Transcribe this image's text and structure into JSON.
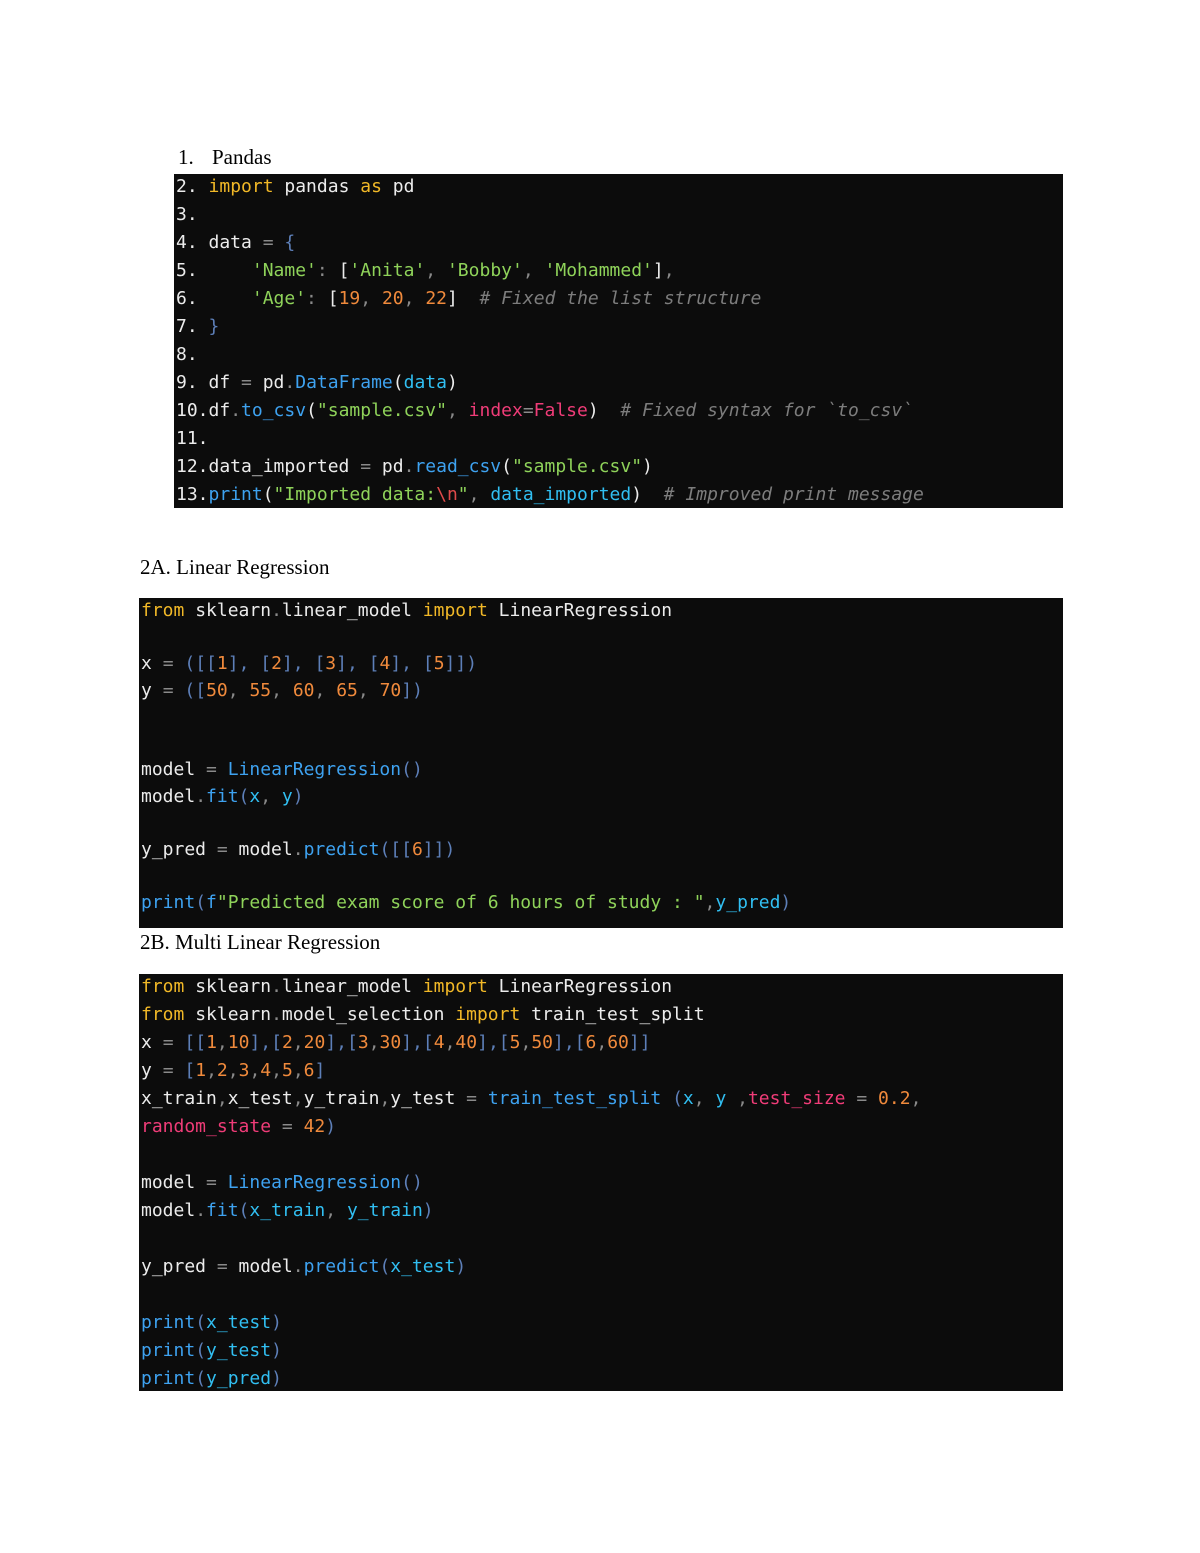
{
  "headings": {
    "pandas_number": "1.",
    "pandas": "Pandas",
    "linear": "2A. Linear Regression",
    "multi": "2B. Multi Linear Regression"
  },
  "code_blocks": [
    {
      "name": "pandas",
      "lines": [
        [
          [
            "w",
            "2. "
          ],
          [
            "kw",
            "import"
          ],
          [
            "w",
            " pandas "
          ],
          [
            "kw",
            "as"
          ],
          [
            "w",
            " pd"
          ]
        ],
        [
          [
            "w",
            "3."
          ]
        ],
        [
          [
            "w",
            "4. data "
          ],
          [
            "g",
            "="
          ],
          [
            "w",
            " "
          ],
          [
            "br2",
            "{"
          ]
        ],
        [
          [
            "w",
            "5.     "
          ],
          [
            "str",
            "'Name'"
          ],
          [
            "g",
            ": "
          ],
          [
            "br",
            "["
          ],
          [
            "str",
            "'Anita'"
          ],
          [
            "g",
            ", "
          ],
          [
            "str",
            "'Bobby'"
          ],
          [
            "g",
            ", "
          ],
          [
            "str",
            "'Mohammed'"
          ],
          [
            "br",
            "]"
          ],
          [
            "g",
            ","
          ]
        ],
        [
          [
            "w",
            "6.     "
          ],
          [
            "str",
            "'Age'"
          ],
          [
            "g",
            ": "
          ],
          [
            "br",
            "["
          ],
          [
            "num",
            "19"
          ],
          [
            "g",
            ", "
          ],
          [
            "num",
            "20"
          ],
          [
            "g",
            ", "
          ],
          [
            "num",
            "22"
          ],
          [
            "br",
            "]"
          ],
          [
            "w",
            "  "
          ],
          [
            "cm",
            "# Fixed the list structure"
          ]
        ],
        [
          [
            "w",
            "7. "
          ],
          [
            "br2",
            "}"
          ]
        ],
        [
          [
            "w",
            "8."
          ]
        ],
        [
          [
            "w",
            "9. df "
          ],
          [
            "g",
            "="
          ],
          [
            "w",
            " pd"
          ],
          [
            "g",
            "."
          ],
          [
            "fn",
            "DataFrame"
          ],
          [
            "br",
            "("
          ],
          [
            "var",
            "data"
          ],
          [
            "br",
            ")"
          ]
        ],
        [
          [
            "w",
            "10.df"
          ],
          [
            "g",
            "."
          ],
          [
            "fn",
            "to_csv"
          ],
          [
            "br",
            "("
          ],
          [
            "str",
            "\"sample.csv\""
          ],
          [
            "g",
            ", "
          ],
          [
            "param",
            "index"
          ],
          [
            "g",
            "="
          ],
          [
            "param",
            "False"
          ],
          [
            "br",
            ")"
          ],
          [
            "w",
            "  "
          ],
          [
            "cm",
            "# Fixed syntax for `to_csv`"
          ]
        ],
        [
          [
            "w",
            "11."
          ]
        ],
        [
          [
            "w",
            "12.data_imported "
          ],
          [
            "g",
            "="
          ],
          [
            "w",
            " pd"
          ],
          [
            "g",
            "."
          ],
          [
            "fn",
            "read_csv"
          ],
          [
            "br",
            "("
          ],
          [
            "str",
            "\"sample.csv\""
          ],
          [
            "br",
            ")"
          ]
        ],
        [
          [
            "w",
            "13."
          ],
          [
            "fn",
            "print"
          ],
          [
            "br",
            "("
          ],
          [
            "str",
            "\"Imported data:"
          ],
          [
            "esc",
            "\\n"
          ],
          [
            "str",
            "\""
          ],
          [
            "g",
            ", "
          ],
          [
            "var",
            "data_imported"
          ],
          [
            "br",
            ")"
          ],
          [
            "w",
            "  "
          ],
          [
            "cm",
            "# Improved print message"
          ]
        ]
      ]
    },
    {
      "name": "linear-regression",
      "lines": [
        [
          [
            "kw",
            "from"
          ],
          [
            "w",
            " sklearn"
          ],
          [
            "g",
            "."
          ],
          [
            "w",
            "linear_model "
          ],
          [
            "kw",
            "import"
          ],
          [
            "w",
            " LinearRegression"
          ]
        ],
        [],
        [
          [
            "w",
            "x "
          ],
          [
            "g",
            "="
          ],
          [
            "w",
            " "
          ],
          [
            "br2",
            "([["
          ],
          [
            "num",
            "1"
          ],
          [
            "br2",
            "], ["
          ],
          [
            "num",
            "2"
          ],
          [
            "br2",
            "], ["
          ],
          [
            "num",
            "3"
          ],
          [
            "br2",
            "], ["
          ],
          [
            "num",
            "4"
          ],
          [
            "br2",
            "], ["
          ],
          [
            "num",
            "5"
          ],
          [
            "br2",
            "]])"
          ]
        ],
        [
          [
            "w",
            "y "
          ],
          [
            "g",
            "="
          ],
          [
            "w",
            " "
          ],
          [
            "br2",
            "(["
          ],
          [
            "num",
            "50"
          ],
          [
            "g",
            ", "
          ],
          [
            "num",
            "55"
          ],
          [
            "g",
            ", "
          ],
          [
            "num",
            "60"
          ],
          [
            "g",
            ", "
          ],
          [
            "num",
            "65"
          ],
          [
            "g",
            ", "
          ],
          [
            "num",
            "70"
          ],
          [
            "br2",
            "])"
          ]
        ],
        [],
        [],
        [
          [
            "w",
            "model "
          ],
          [
            "g",
            "="
          ],
          [
            "w",
            " "
          ],
          [
            "fn",
            "LinearRegression"
          ],
          [
            "br2",
            "()"
          ]
        ],
        [
          [
            "w",
            "model"
          ],
          [
            "g",
            "."
          ],
          [
            "fn",
            "fit"
          ],
          [
            "br2",
            "("
          ],
          [
            "var",
            "x"
          ],
          [
            "g",
            ", "
          ],
          [
            "var",
            "y"
          ],
          [
            "br2",
            ")"
          ]
        ],
        [],
        [
          [
            "w",
            "y_pred "
          ],
          [
            "g",
            "="
          ],
          [
            "w",
            " model"
          ],
          [
            "g",
            "."
          ],
          [
            "fn",
            "predict"
          ],
          [
            "br2",
            "([["
          ],
          [
            "num",
            "6"
          ],
          [
            "br2",
            "]])"
          ]
        ],
        [],
        [
          [
            "fn",
            "print"
          ],
          [
            "br2",
            "("
          ],
          [
            "fn",
            "f"
          ],
          [
            "str",
            "\"Predicted exam score of 6 hours of study : \""
          ],
          [
            "g",
            ","
          ],
          [
            "var",
            "y_pred"
          ],
          [
            "br2",
            ")"
          ]
        ]
      ]
    },
    {
      "name": "multi-linear-regression",
      "lines": [
        [
          [
            "kw",
            "from"
          ],
          [
            "w",
            " sklearn"
          ],
          [
            "g",
            "."
          ],
          [
            "w",
            "linear_model "
          ],
          [
            "kw",
            "import"
          ],
          [
            "w",
            " LinearRegression"
          ]
        ],
        [
          [
            "kw",
            "from"
          ],
          [
            "w",
            " sklearn"
          ],
          [
            "g",
            "."
          ],
          [
            "w",
            "model_selection "
          ],
          [
            "kw",
            "import"
          ],
          [
            "w",
            " train_test_split"
          ]
        ],
        [
          [
            "w",
            "x "
          ],
          [
            "g",
            "="
          ],
          [
            "w",
            " "
          ],
          [
            "br2",
            "[["
          ],
          [
            "num",
            "1"
          ],
          [
            "g",
            ","
          ],
          [
            "num",
            "10"
          ],
          [
            "br2",
            "],["
          ],
          [
            "num",
            "2"
          ],
          [
            "g",
            ","
          ],
          [
            "num",
            "20"
          ],
          [
            "br2",
            "],["
          ],
          [
            "num",
            "3"
          ],
          [
            "g",
            ","
          ],
          [
            "num",
            "30"
          ],
          [
            "br2",
            "],["
          ],
          [
            "num",
            "4"
          ],
          [
            "g",
            ","
          ],
          [
            "num",
            "40"
          ],
          [
            "br2",
            "],["
          ],
          [
            "num",
            "5"
          ],
          [
            "g",
            ","
          ],
          [
            "num",
            "50"
          ],
          [
            "br2",
            "],["
          ],
          [
            "num",
            "6"
          ],
          [
            "g",
            ","
          ],
          [
            "num",
            "60"
          ],
          [
            "br2",
            "]]"
          ]
        ],
        [
          [
            "w",
            "y "
          ],
          [
            "g",
            "="
          ],
          [
            "w",
            " "
          ],
          [
            "br2",
            "["
          ],
          [
            "num",
            "1"
          ],
          [
            "g",
            ","
          ],
          [
            "num",
            "2"
          ],
          [
            "g",
            ","
          ],
          [
            "num",
            "3"
          ],
          [
            "g",
            ","
          ],
          [
            "num",
            "4"
          ],
          [
            "g",
            ","
          ],
          [
            "num",
            "5"
          ],
          [
            "g",
            ","
          ],
          [
            "num",
            "6"
          ],
          [
            "br2",
            "]"
          ]
        ],
        [
          [
            "w",
            "x_train"
          ],
          [
            "g",
            ","
          ],
          [
            "w",
            "x_test"
          ],
          [
            "g",
            ","
          ],
          [
            "w",
            "y_train"
          ],
          [
            "g",
            ","
          ],
          [
            "w",
            "y_test "
          ],
          [
            "g",
            "="
          ],
          [
            "w",
            " "
          ],
          [
            "fn",
            "train_test_split"
          ],
          [
            "w",
            " "
          ],
          [
            "br2",
            "("
          ],
          [
            "var",
            "x"
          ],
          [
            "g",
            ", "
          ],
          [
            "var",
            "y"
          ],
          [
            "w",
            " "
          ],
          [
            "g",
            ","
          ],
          [
            "param",
            "test_size"
          ],
          [
            "w",
            " "
          ],
          [
            "g",
            "="
          ],
          [
            "w",
            " "
          ],
          [
            "num",
            "0.2"
          ],
          [
            "g",
            ","
          ]
        ],
        [
          [
            "param",
            "random_state"
          ],
          [
            "w",
            " "
          ],
          [
            "g",
            "="
          ],
          [
            "w",
            " "
          ],
          [
            "num",
            "42"
          ],
          [
            "br2",
            ")"
          ]
        ],
        [],
        [
          [
            "w",
            "model "
          ],
          [
            "g",
            "="
          ],
          [
            "w",
            " "
          ],
          [
            "fn",
            "LinearRegression"
          ],
          [
            "br2",
            "()"
          ]
        ],
        [
          [
            "w",
            "model"
          ],
          [
            "g",
            "."
          ],
          [
            "fn",
            "fit"
          ],
          [
            "br2",
            "("
          ],
          [
            "var",
            "x_train"
          ],
          [
            "g",
            ", "
          ],
          [
            "var",
            "y_train"
          ],
          [
            "br2",
            ")"
          ]
        ],
        [],
        [
          [
            "w",
            "y_pred "
          ],
          [
            "g",
            "="
          ],
          [
            "w",
            " model"
          ],
          [
            "g",
            "."
          ],
          [
            "fn",
            "predict"
          ],
          [
            "br2",
            "("
          ],
          [
            "var",
            "x_test"
          ],
          [
            "br2",
            ")"
          ]
        ],
        [],
        [
          [
            "fn",
            "print"
          ],
          [
            "br2",
            "("
          ],
          [
            "var",
            "x_test"
          ],
          [
            "br2",
            ")"
          ]
        ],
        [
          [
            "fn",
            "print"
          ],
          [
            "br2",
            "("
          ],
          [
            "var",
            "y_test"
          ],
          [
            "br2",
            ")"
          ]
        ],
        [
          [
            "fn",
            "print"
          ],
          [
            "br2",
            "("
          ],
          [
            "var",
            "y_pred"
          ],
          [
            "br2",
            ")"
          ]
        ]
      ]
    }
  ]
}
